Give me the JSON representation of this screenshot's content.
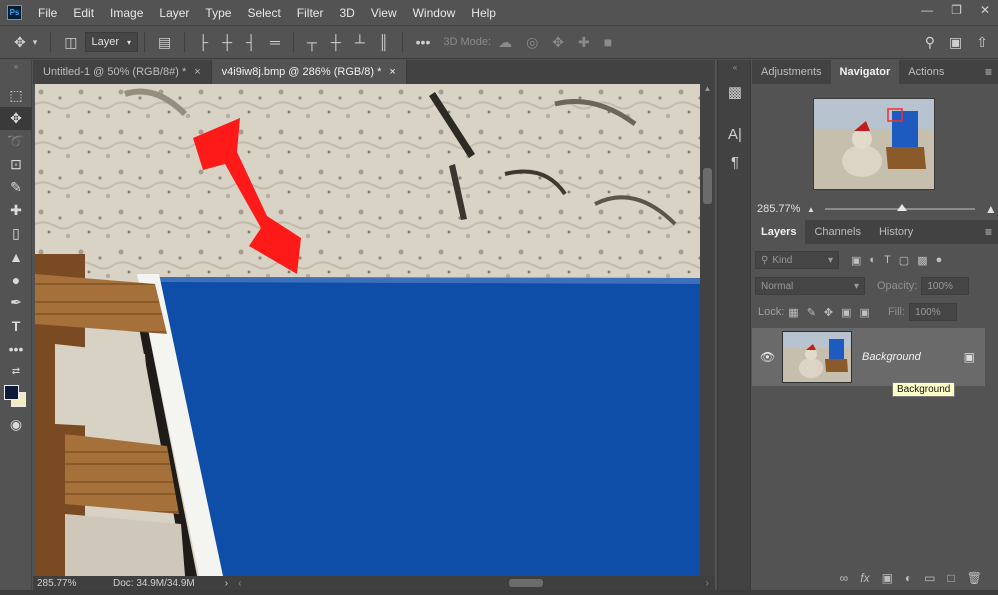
{
  "app": {
    "logo_text": "Ps"
  },
  "menu": [
    "File",
    "Edit",
    "Image",
    "Layer",
    "Type",
    "Select",
    "Filter",
    "3D",
    "View",
    "Window",
    "Help"
  ],
  "window_controls": [
    "minimize-icon",
    "restore-icon",
    "close-icon"
  ],
  "options_bar": {
    "layer_select_value": "Layer",
    "mode_3d_label": "3D Mode:"
  },
  "tabs": [
    {
      "label": "Untitled-1 @ 50% (RGB/8#) *",
      "close": "×",
      "active": false
    },
    {
      "label": "v4i9iw8j.bmp @ 286% (RGB/8) *",
      "close": "×",
      "active": true
    }
  ],
  "status_bar": {
    "zoom": "285.77%",
    "doc_info": "Doc: 34.9M/34.9M"
  },
  "panels": {
    "top_tabs": [
      "Adjustments",
      "Navigator",
      "Actions"
    ],
    "top_active": "Navigator",
    "navigator_zoom": "285.77%",
    "layers_tabs": [
      "Layers",
      "Channels",
      "History"
    ],
    "layers_active": "Layers",
    "kind_label": "Kind",
    "blend_mode": "Normal",
    "opacity_label": "Opacity:",
    "opacity_value": "100%",
    "lock_label": "Lock:",
    "fill_label": "Fill:",
    "fill_value": "100%",
    "layer_name": "Background",
    "tooltip": "Background"
  },
  "colors": {
    "accent": "#31a8ff",
    "panel_bg": "#535353",
    "dark_bg": "#424242",
    "sign_blue": "#0f4ea8",
    "arrow_red": "#ff1a1a"
  }
}
